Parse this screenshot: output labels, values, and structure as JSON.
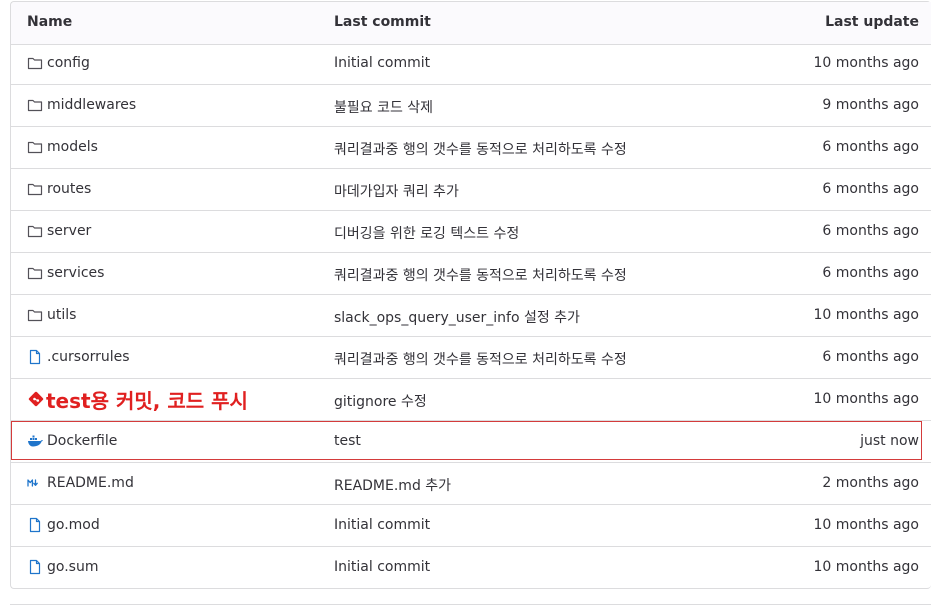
{
  "table": {
    "headers": {
      "name": "Name",
      "commit": "Last commit",
      "update": "Last update"
    },
    "rows": [
      {
        "icon": "folder-icon",
        "name": "config",
        "commit": "Initial commit",
        "update": "10 months ago"
      },
      {
        "icon": "folder-icon",
        "name": "middlewares",
        "commit": "불필요 코드 삭제",
        "update": "9 months ago"
      },
      {
        "icon": "folder-icon",
        "name": "models",
        "commit": "쿼리결과중 행의 갯수를 동적으로 처리하도록 수정",
        "update": "6 months ago"
      },
      {
        "icon": "folder-icon",
        "name": "routes",
        "commit": "마데가입자 쿼리 추가",
        "update": "6 months ago"
      },
      {
        "icon": "folder-icon",
        "name": "server",
        "commit": "디버깅을 위한 로깅 텍스트 수정",
        "update": "6 months ago"
      },
      {
        "icon": "folder-icon",
        "name": "services",
        "commit": "쿼리결과중 행의 갯수를 동적으로 처리하도록 수정",
        "update": "6 months ago"
      },
      {
        "icon": "folder-icon",
        "name": "utils",
        "commit": "slack_ops_query_user_info 설정 추가",
        "update": "10 months ago"
      },
      {
        "icon": "file-icon",
        "name": ".cursorrules",
        "commit": "쿼리결과중 행의 갯수를 동적으로 처리하도록 수정",
        "update": "6 months ago"
      },
      {
        "icon": "git-icon",
        "name": "",
        "commit": "gitignore 수정",
        "update": "10 months ago"
      },
      {
        "icon": "docker-icon",
        "name": "Dockerfile",
        "commit": "test",
        "update": "just now"
      },
      {
        "icon": "markdown-icon",
        "name": "README.md",
        "commit": "README.md 추가",
        "update": "2 months ago"
      },
      {
        "icon": "file-icon",
        "name": "go.mod",
        "commit": "Initial commit",
        "update": "10 months ago"
      },
      {
        "icon": "file-icon",
        "name": "go.sum",
        "commit": "Initial commit",
        "update": "10 months ago"
      }
    ]
  },
  "annotation": {
    "text": "test용 커밋, 코드 푸시",
    "color": "#e02020"
  },
  "colors": {
    "border": "#dcdcde",
    "header_bg": "#fbfafd",
    "highlight": "#d43b3b",
    "link_blue": "#1f75cb"
  }
}
